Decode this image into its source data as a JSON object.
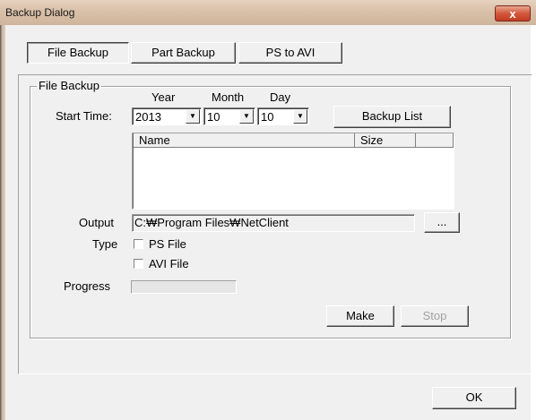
{
  "window": {
    "title": "Backup Dialog",
    "close_symbol": "x"
  },
  "tabs": [
    {
      "label": "File Backup"
    },
    {
      "label": "Part Backup"
    },
    {
      "label": "PS to AVI"
    }
  ],
  "group": {
    "title": "File Backup",
    "start_time_label": "Start Time:",
    "year_label": "Year",
    "month_label": "Month",
    "day_label": "Day",
    "year_value": "2013",
    "month_value": "10",
    "day_value": "10",
    "backup_list_label": "Backup List",
    "list_headers": [
      "Name",
      "Size"
    ],
    "output_label": "Output",
    "output_value": "C:₩Program Files₩NetClient",
    "browse_label": "...",
    "type_label": "Type",
    "ps_file_label": "PS File",
    "avi_file_label": "AVI File",
    "progress_label": "Progress",
    "progress_value": 0,
    "make_label": "Make",
    "stop_label": "Stop"
  },
  "ok_label": "OK",
  "icons": {
    "dropdown": "▼"
  }
}
